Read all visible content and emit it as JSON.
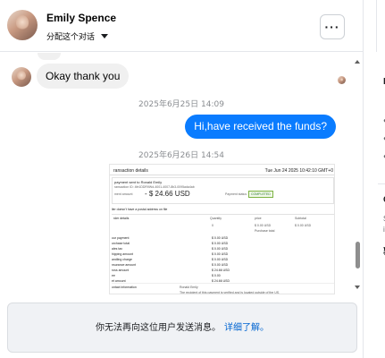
{
  "header": {
    "contact_name": "Emily Spence",
    "assign_label": "分配这个对话",
    "more_label": "···"
  },
  "conversation": {
    "messages": [
      {
        "direction": "in",
        "text": "Okay thank you"
      },
      {
        "direction": "out",
        "text": "Hi,have received the funds?"
      }
    ],
    "timestamps": [
      "2025年6月25日 14:09",
      "2025年6月26日 14:54"
    ]
  },
  "receipt": {
    "title": "ransaction details",
    "date": "Tue Jun 24 2025 10:42:10 GMT+0",
    "sent_to": "payment sent to Ronald Emily",
    "transaction_id": "ransaction ID: 4fe1DDR9Wd-4001-4007-8b3-0095ada4ab",
    "amount_label": "ment amount",
    "amount": "- $ 24.66 USD",
    "status_label": "Payment status",
    "status": "COMPLETED",
    "note": "ller doesn't have a postal address on file",
    "order_label": "rder details",
    "col_quantity": "Quantity",
    "col_price": "price",
    "col_subtotal": "Subtotal",
    "qty": "0",
    "price": "$ 0.00 USD",
    "subtotal": "$ 0.00 USD",
    "handling": "Purchase total",
    "lines": [
      {
        "k": "our payment",
        "v": "$ 0.00 USD"
      },
      {
        "k": "urchase total",
        "v": "$ 0.00 USD"
      },
      {
        "k": "ales tax",
        "v": "$ 0.00 USD"
      },
      {
        "k": "hipping amount",
        "v": "$ 0.00 USD"
      },
      {
        "k": "andling charge",
        "v": "$ 0.00 USD"
      },
      {
        "k": "nsurance amount",
        "v": "$ 0.00 USD"
      },
      {
        "k": "ross amount",
        "v": "$ 24.66 USD"
      },
      {
        "k": "ee",
        "v": "$ 0.00"
      },
      {
        "k": "et amount",
        "v": "$ 24.66 USD"
      }
    ],
    "contact_label": "ontact information",
    "contact_name": "Ronald Emily",
    "contact_desc": "The recipient of this payment is verified and is located outside of the US."
  },
  "footer": {
    "message": "你无法再向这位用户发送消息。",
    "learn_more": "详细了解。"
  },
  "right_panel": {
    "letters": [
      "F",
      "C",
      "敦"
    ],
    "small": [
      "S",
      "i"
    ]
  },
  "colors": {
    "outgoing_bubble": "#0a7cff",
    "incoming_bubble": "#f0f0f0",
    "link": "#0064d1"
  }
}
